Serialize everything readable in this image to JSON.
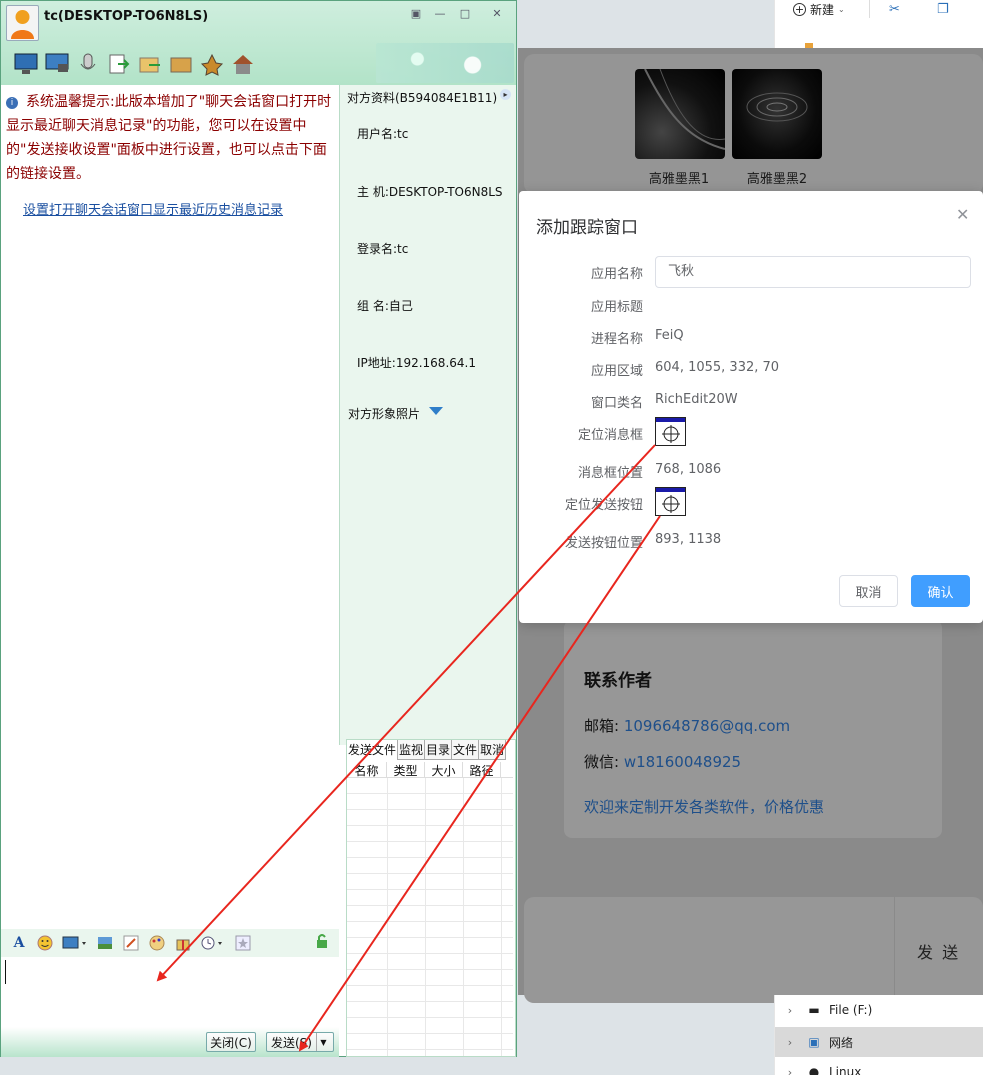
{
  "explorer": {
    "new_label": "新建",
    "partial_text": "...",
    "tree": [
      {
        "label": "File (F:)"
      },
      {
        "label": "网络"
      },
      {
        "label": "Linux"
      }
    ]
  },
  "background_app": {
    "thumbs": [
      {
        "label": "高雅墨黑1"
      },
      {
        "label": "高雅墨黑2"
      }
    ],
    "contact": {
      "heading": "联系作者",
      "email_label": "邮箱: ",
      "email": "1096648786@qq.com",
      "wechat_label": "微信: ",
      "wechat": "w18160048925",
      "promo": "欢迎来定制开发各类软件，价格优惠"
    },
    "send_label": "发 送"
  },
  "dialog": {
    "title": "添加跟踪窗口",
    "fields": {
      "app_name_label": "应用名称",
      "app_name_value": "飞秋",
      "app_title_label": "应用标题",
      "process_label": "进程名称",
      "process_value": "FeiQ",
      "region_label": "应用区域",
      "region_value": "604, 1055, 332, 70",
      "class_label": "窗口类名",
      "class_value": "RichEdit20W",
      "locate_msg_label": "定位消息框",
      "msg_pos_label": "消息框位置",
      "msg_pos_value": "768, 1086",
      "locate_send_label": "定位发送按钮",
      "send_pos_label": "发送按钮位置",
      "send_pos_value": "893, 1138"
    },
    "cancel_label": "取消",
    "confirm_label": "确认"
  },
  "chat": {
    "title": "tc(DESKTOP-TO6N8LS)",
    "notice": "系统温馨提示:此版本增加了\"聊天会话窗口打开时显示最近聊天消息记录\"的功能，您可以在设置中的\"发送接收设置\"面板中进行设置，也可以点击下面的链接设置。",
    "notice_link": "设置打开聊天会话窗口显示最近历史消息记录",
    "side": {
      "header": "对方资料(B594084E1B11)",
      "username": "用户名:tc",
      "host": "主  机:DESKTOP-TO6N8LS",
      "login": "登录名:tc",
      "group": "组  名:自己",
      "ip": "IP地址:192.168.64.1",
      "photo": "对方形象照片"
    },
    "file_tabs": [
      "发送文件",
      "监视",
      "目录",
      "文件",
      "取消"
    ],
    "file_columns": [
      "名称",
      "类型",
      "大小",
      "路径"
    ],
    "close_label": "关闭(C)",
    "send_label": "发送(S)"
  }
}
